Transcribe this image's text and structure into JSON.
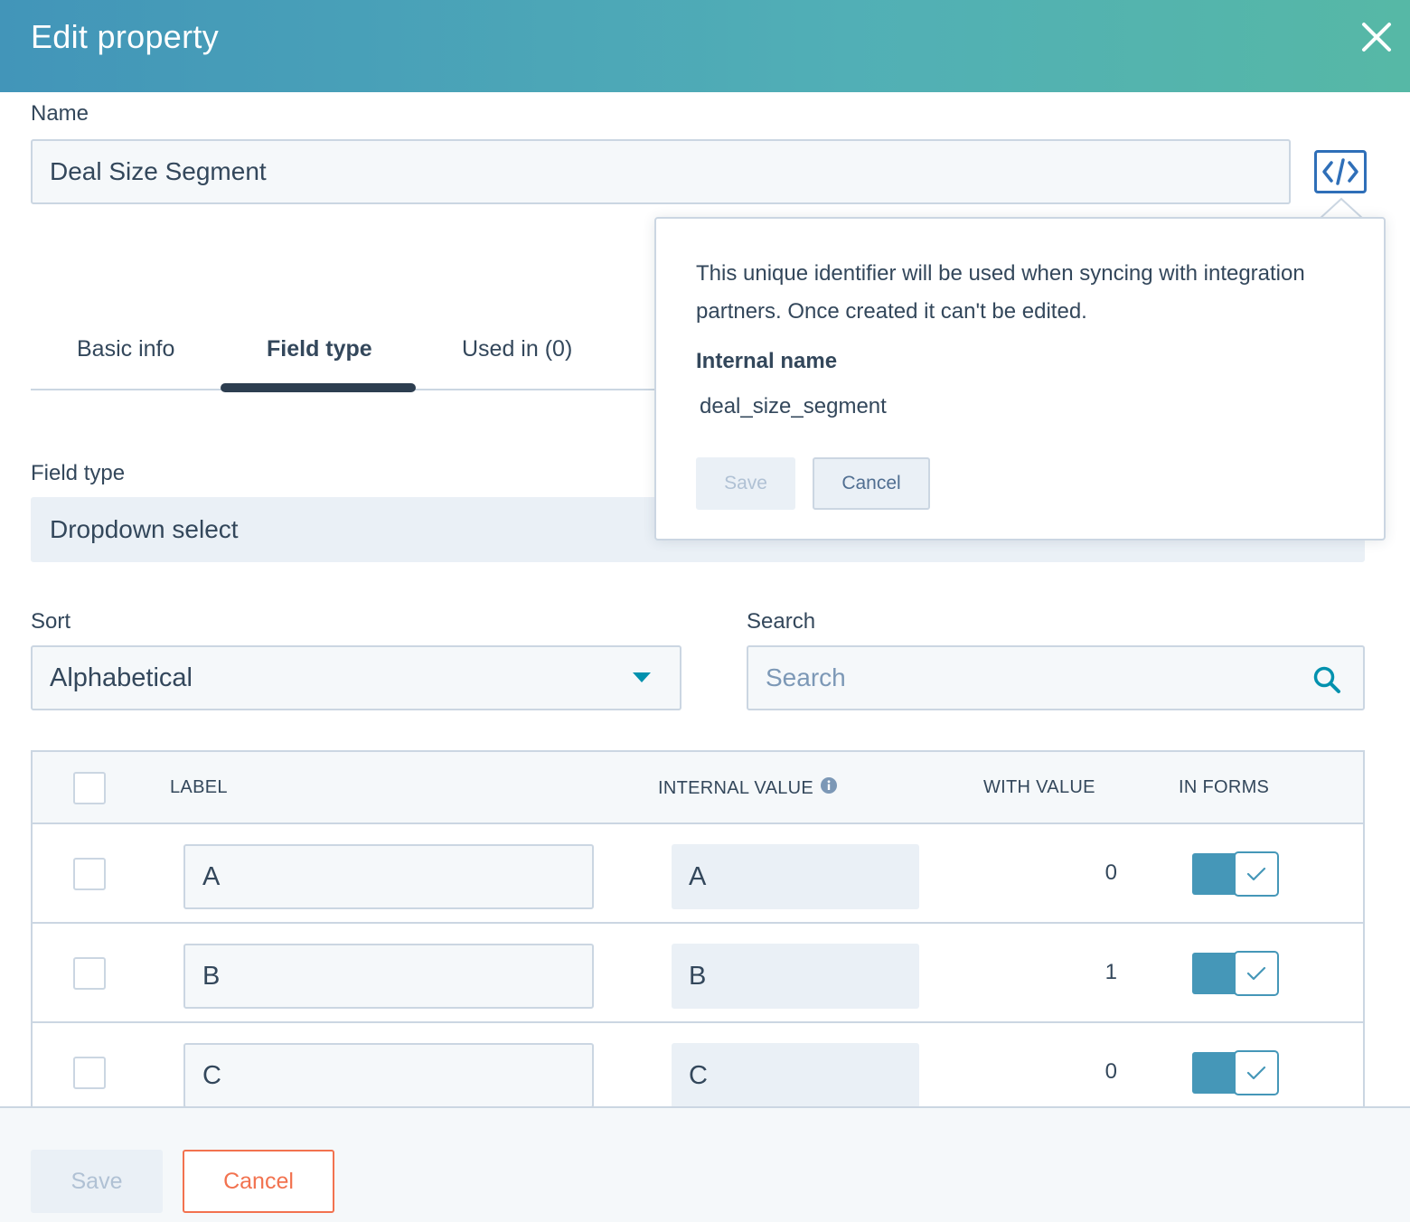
{
  "dialog": {
    "title": "Edit property"
  },
  "name": {
    "label": "Name",
    "value": "Deal Size Segment"
  },
  "tabs": [
    {
      "label": "Basic info",
      "active": false
    },
    {
      "label": "Field type",
      "active": true
    },
    {
      "label": "Used in (0)",
      "active": false
    }
  ],
  "field_type": {
    "label": "Field type",
    "value": "Dropdown select"
  },
  "sort": {
    "label": "Sort",
    "value": "Alphabetical"
  },
  "search": {
    "label": "Search",
    "placeholder": "Search"
  },
  "table": {
    "columns": {
      "label": "LABEL",
      "internal_value": "INTERNAL VALUE",
      "with_value": "WITH VALUE",
      "in_forms": "IN FORMS"
    },
    "rows": [
      {
        "label": "A",
        "internal_value": "A",
        "with_value": "0",
        "in_forms": true
      },
      {
        "label": "B",
        "internal_value": "B",
        "with_value": "1",
        "in_forms": true
      },
      {
        "label": "C",
        "internal_value": "C",
        "with_value": "0",
        "in_forms": true
      }
    ]
  },
  "popover": {
    "description": "This unique identifier will be used when syncing with integration partners. Once created it can't be edited.",
    "internal_name_label": "Internal name",
    "internal_name_value": "deal_size_segment",
    "save_label": "Save",
    "cancel_label": "Cancel"
  },
  "footer": {
    "save_label": "Save",
    "cancel_label": "Cancel"
  },
  "colors": {
    "header_start": "#4295b9",
    "header_end": "#56b8a6",
    "accent": "#0091ae",
    "toggle": "#4597b8",
    "cancel": "#f2724f"
  },
  "icons": [
    "close-icon",
    "code-icon",
    "caret-down-icon",
    "search-icon",
    "info-icon",
    "check-icon"
  ]
}
